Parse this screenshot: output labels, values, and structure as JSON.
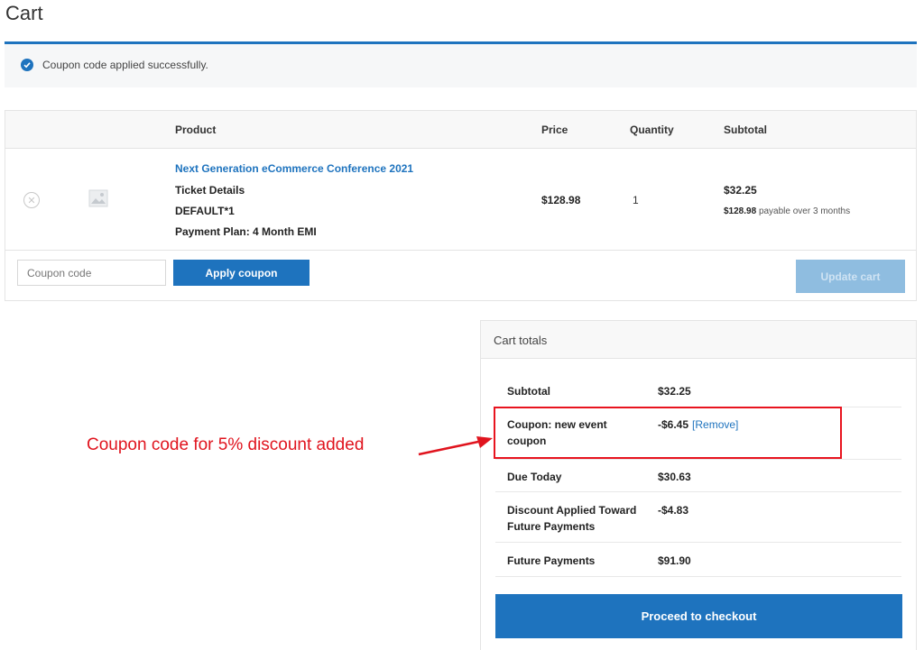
{
  "page": {
    "title": "Cart"
  },
  "notice": {
    "message": "Coupon code applied successfully."
  },
  "table": {
    "headers": {
      "product": "Product",
      "price": "Price",
      "quantity": "Quantity",
      "subtotal": "Subtotal"
    },
    "item": {
      "name": "Next Generation eCommerce Conference 2021",
      "meta": [
        "Ticket Details",
        "DEFAULT*1",
        "Payment Plan: 4 Month EMI"
      ],
      "price": "$128.98",
      "quantity": "1",
      "subtotal": "$32.25",
      "plan_amount": "$128.98",
      "plan_text": "payable over 3 months"
    }
  },
  "actions": {
    "coupon_placeholder": "Coupon code",
    "apply_label": "Apply coupon",
    "update_label": "Update cart"
  },
  "totals": {
    "title": "Cart totals",
    "rows": [
      {
        "label": "Subtotal",
        "value": "$32.25"
      },
      {
        "label": "Coupon: new event coupon",
        "value": "-$6.45",
        "link": "[Remove]"
      },
      {
        "label": "Due Today",
        "value": "$30.63"
      },
      {
        "label": "Discount Applied Toward Future Payments",
        "value": "-$4.83"
      },
      {
        "label": "Future Payments",
        "value": "$91.90"
      }
    ],
    "checkout_label": "Proceed to checkout"
  },
  "annotation": {
    "text": "Coupon code for 5% discount added",
    "color": "#e0141e"
  },
  "colors": {
    "accent": "#1e73be",
    "highlight": "#e8141f"
  }
}
